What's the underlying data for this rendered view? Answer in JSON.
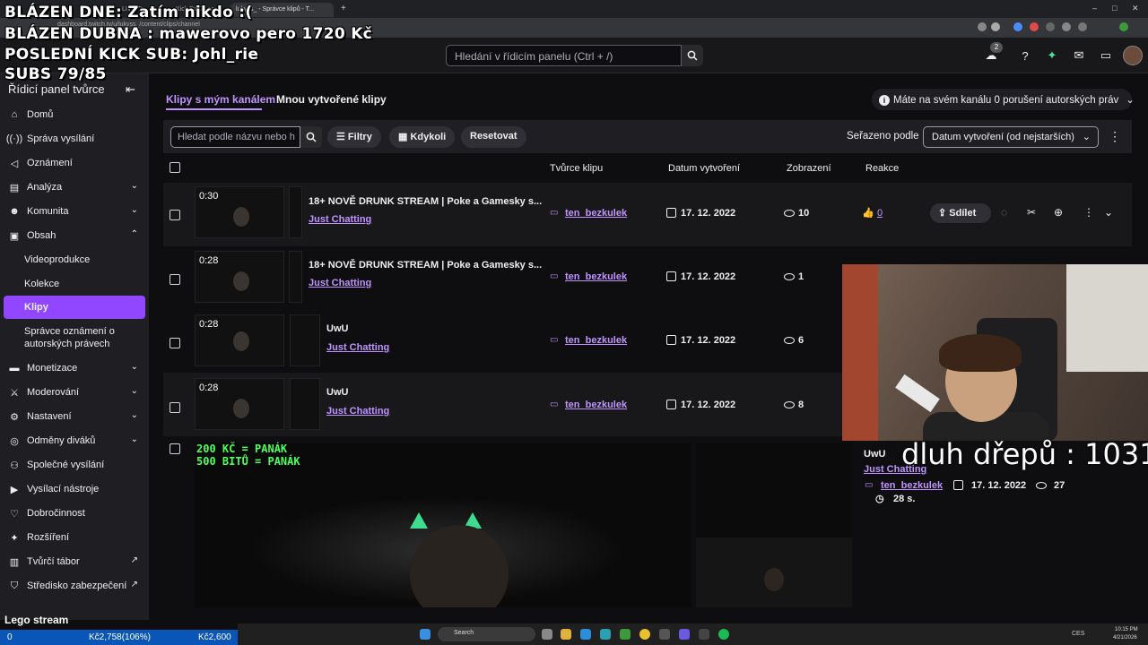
{
  "browser": {
    "tabs": [
      "",
      "LIVE Ta...",
      "Kick Dashboa...",
      "lukyss_ - Správce klipů - T..."
    ],
    "url": "dashboard.twitch.tv/u/lukyss_/content/clips/channel"
  },
  "overlay": {
    "line1": "BLÁZEN DNE: Zatím nikdo :(",
    "line2": "BLÁZEN DUBNA : mawerovo pero 1720 Kč",
    "line3": "POSLEDNÍ KICK SUB: Johl_rie",
    "line4": "SUBS 79/85",
    "lego": "Lego stream",
    "dluh": "dluh dřepů : 1031",
    "green1": "200 KČ = PANÁK",
    "green2": "500 BITŮ = PANÁK"
  },
  "header": {
    "search_placeholder": "Hledání v řídicím panelu (Ctrl + /)",
    "notif_count": "2"
  },
  "sidebar": {
    "title": "Řídicí panel tvůrce",
    "items": [
      {
        "label": "Domů",
        "icon": "home-icon"
      },
      {
        "label": "Správa vysílání",
        "icon": "broadcast-icon"
      },
      {
        "label": "Oznámení",
        "icon": "megaphone-icon"
      },
      {
        "label": "Analýza",
        "icon": "chart-icon"
      },
      {
        "label": "Komunita",
        "icon": "users-icon"
      },
      {
        "label": "Obsah",
        "icon": "content-icon"
      }
    ],
    "sub_items": [
      "Videoprodukce",
      "Kolekce",
      "Klipy",
      "Správce oznámení o",
      "autorských právech"
    ],
    "items2": [
      {
        "label": "Monetizace"
      },
      {
        "label": "Moderování"
      },
      {
        "label": "Nastavení"
      },
      {
        "label": "Odměny diváků"
      },
      {
        "label": "Společné vysílání"
      },
      {
        "label": "Vysílací nástroje"
      },
      {
        "label": "Dobročinnost"
      },
      {
        "label": "Rozšíření"
      },
      {
        "label": "Tvůrčí tábor"
      },
      {
        "label": "Středisko zabezpečení"
      }
    ]
  },
  "main": {
    "tab1": "Klipy s mým kanálem",
    "tab2": "Mnou vytvořené klipy",
    "copyright": "Máte na svém kanálu 0 porušení autorských práv",
    "search_placeholder": "Hledat podle názvu nebo h",
    "filters": "Filtry",
    "anytime": "Kdykoli",
    "reset": "Resetovat",
    "sort_label": "Seřazeno podle",
    "sort_value": "Datum vytvoření (od nejstarších)",
    "col_creator": "Tvůrce klipu",
    "col_date": "Datum vytvoření",
    "col_views": "Zobrazení",
    "col_reactions": "Reakce",
    "share": "Sdílet",
    "like_count": "0",
    "rows": [
      {
        "dur": "0:30",
        "title": "18+ NOVĚ DRUNK STREAM | Poke a Gamesky s...",
        "cat": "Just Chatting",
        "creator": "ten_bezkulek",
        "date": "17. 12. 2022",
        "views": "10"
      },
      {
        "dur": "0:28",
        "title": "18+ NOVĚ DRUNK STREAM | Poke a Gamesky s...",
        "cat": "Just Chatting",
        "creator": "ten_bezkulek",
        "date": "17. 12. 2022",
        "views": "1"
      },
      {
        "dur": "0:28",
        "title": "UwU",
        "cat": "Just Chatting",
        "creator": "ten_bezkulek",
        "date": "17. 12. 2022",
        "views": "6"
      },
      {
        "dur": "0:28",
        "title": "UwU",
        "cat": "Just Chatting",
        "creator": "ten_bezkulek",
        "date": "17. 12. 2022",
        "views": "8"
      }
    ],
    "expanded": {
      "title": "UwU",
      "cat": "Just Chatting",
      "creator": "ten_bezkulek",
      "date": "17. 12. 2022",
      "views": "27",
      "length": "28 s."
    }
  },
  "stock": {
    "left": "0",
    "mid": "Kč2,758(106%)",
    "right": "Kč2,600"
  },
  "taskbar": {
    "search": "Search",
    "lang": "CES",
    "time": "10:15 PM",
    "date": "4/21/2026"
  }
}
